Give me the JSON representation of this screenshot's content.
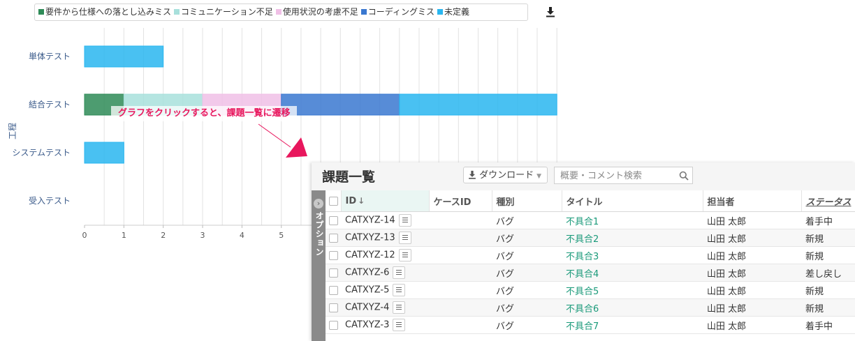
{
  "legend": {
    "items": [
      {
        "label": "要件から仕様への落とし込みミス",
        "color": "#2e8b57"
      },
      {
        "label": "コミュニケーション不足",
        "color": "#a8e0dc"
      },
      {
        "label": "使用状況の考慮不足",
        "color": "#f0c0e6"
      },
      {
        "label": "コーディングミス",
        "color": "#3a78d0"
      },
      {
        "label": "未定義",
        "color": "#29b6f0"
      }
    ],
    "download_icon": "download-icon"
  },
  "chart_data": {
    "type": "bar",
    "orientation": "horizontal",
    "stacked": true,
    "categories": [
      "単体テスト",
      "結合テスト",
      "システムテスト",
      "受入テスト"
    ],
    "series": [
      {
        "name": "要件から仕様への落とし込みミス",
        "color": "#2e8b57",
        "values": [
          0,
          1,
          0,
          0
        ]
      },
      {
        "name": "コミュニケーション不足",
        "color": "#a8e0dc",
        "values": [
          0,
          2,
          0,
          0
        ]
      },
      {
        "name": "使用状況の考慮不足",
        "color": "#f0c0e6",
        "values": [
          0,
          2,
          0,
          0
        ]
      },
      {
        "name": "コーディングミス",
        "color": "#3a78d0",
        "values": [
          0,
          3,
          0,
          0
        ]
      },
      {
        "name": "未定義",
        "color": "#29b6f0",
        "values": [
          2,
          4,
          1,
          0
        ]
      }
    ],
    "xticks": [
      "0",
      "1",
      "2",
      "3",
      "4",
      "5"
    ],
    "xlim": [
      0,
      12
    ],
    "ylabel": "工程",
    "grid": true,
    "legend_position": "top"
  },
  "annotation": {
    "text": "グラフをクリックすると、課題一覧に遷移",
    "color": "#e8175d"
  },
  "issue_list": {
    "title": "課題一覧",
    "download_label": "ダウンロード",
    "search_placeholder": "概要・コメント検索",
    "option_label": "オプション",
    "columns": [
      "ID",
      "ケースID",
      "種別",
      "タイトル",
      "担当者",
      "ステータス"
    ],
    "rows": [
      {
        "id": "CATXYZ-14",
        "case_id": "",
        "type": "バグ",
        "title": "不具合1",
        "assignee": "山田 太郎",
        "status": "着手中"
      },
      {
        "id": "CATXYZ-13",
        "case_id": "",
        "type": "バグ",
        "title": "不具合2",
        "assignee": "山田 太郎",
        "status": "新規"
      },
      {
        "id": "CATXYZ-12",
        "case_id": "",
        "type": "バグ",
        "title": "不具合3",
        "assignee": "山田 太郎",
        "status": "新規"
      },
      {
        "id": "CATXYZ-6",
        "case_id": "",
        "type": "バグ",
        "title": "不具合4",
        "assignee": "山田 太郎",
        "status": "差し戻し"
      },
      {
        "id": "CATXYZ-5",
        "case_id": "",
        "type": "バグ",
        "title": "不具合5",
        "assignee": "山田 太郎",
        "status": "新規"
      },
      {
        "id": "CATXYZ-4",
        "case_id": "",
        "type": "バグ",
        "title": "不具合6",
        "assignee": "山田 太郎",
        "status": "新規"
      },
      {
        "id": "CATXYZ-3",
        "case_id": "",
        "type": "バグ",
        "title": "不具合7",
        "assignee": "山田 太郎",
        "status": "着手中"
      }
    ]
  }
}
